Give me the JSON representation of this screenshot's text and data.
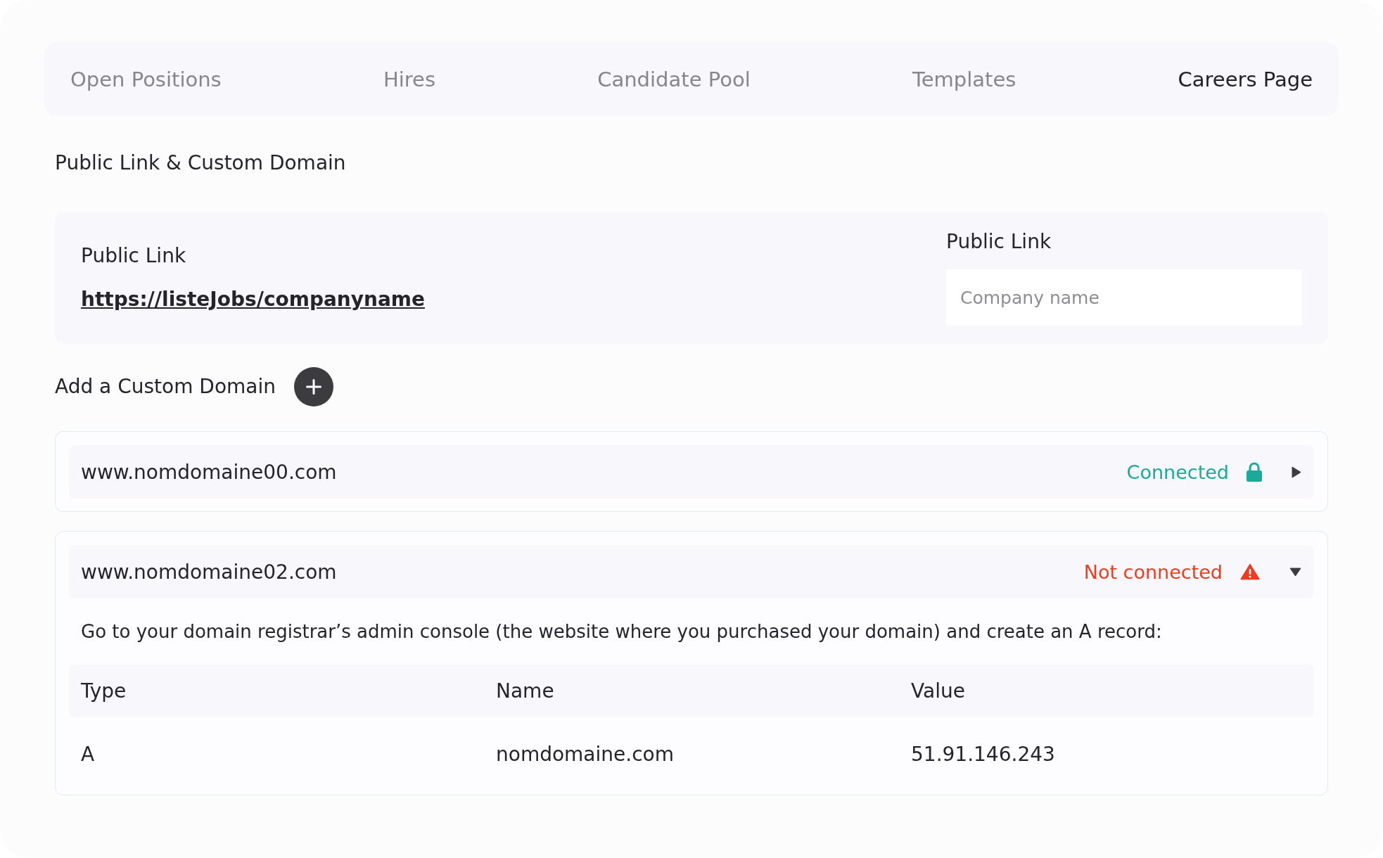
{
  "tabs": [
    {
      "label": "Open Positions",
      "selected": false
    },
    {
      "label": "Hires",
      "selected": false
    },
    {
      "label": "Candidate Pool",
      "selected": false
    },
    {
      "label": "Templates",
      "selected": false
    },
    {
      "label": "Careers Page",
      "selected": true
    }
  ],
  "section_title": "Public Link & Custom Domain",
  "public_link_card": {
    "label": "Public Link",
    "url": "https://listeJobs/companyname",
    "field": {
      "label": "Public Link",
      "placeholder": "Company name"
    }
  },
  "custom_domains": {
    "title": "Add a Custom Domain",
    "items": [
      {
        "domain": "www.nomdomaine00.com",
        "status": "Connected",
        "kind": "connected",
        "expanded": false
      },
      {
        "domain": "www.nomdomaine02.com",
        "status": "Not connected",
        "kind": "not_connected",
        "expanded": true,
        "instructions": "Go to your domain registrar’s admin console (the website where you purchased your domain) and create an A record:",
        "table": {
          "columns": [
            "Type",
            "Name",
            "Value"
          ],
          "rows": [
            [
              "A",
              "nomdomaine.com",
              "51.91.146.243"
            ]
          ]
        }
      }
    ]
  }
}
